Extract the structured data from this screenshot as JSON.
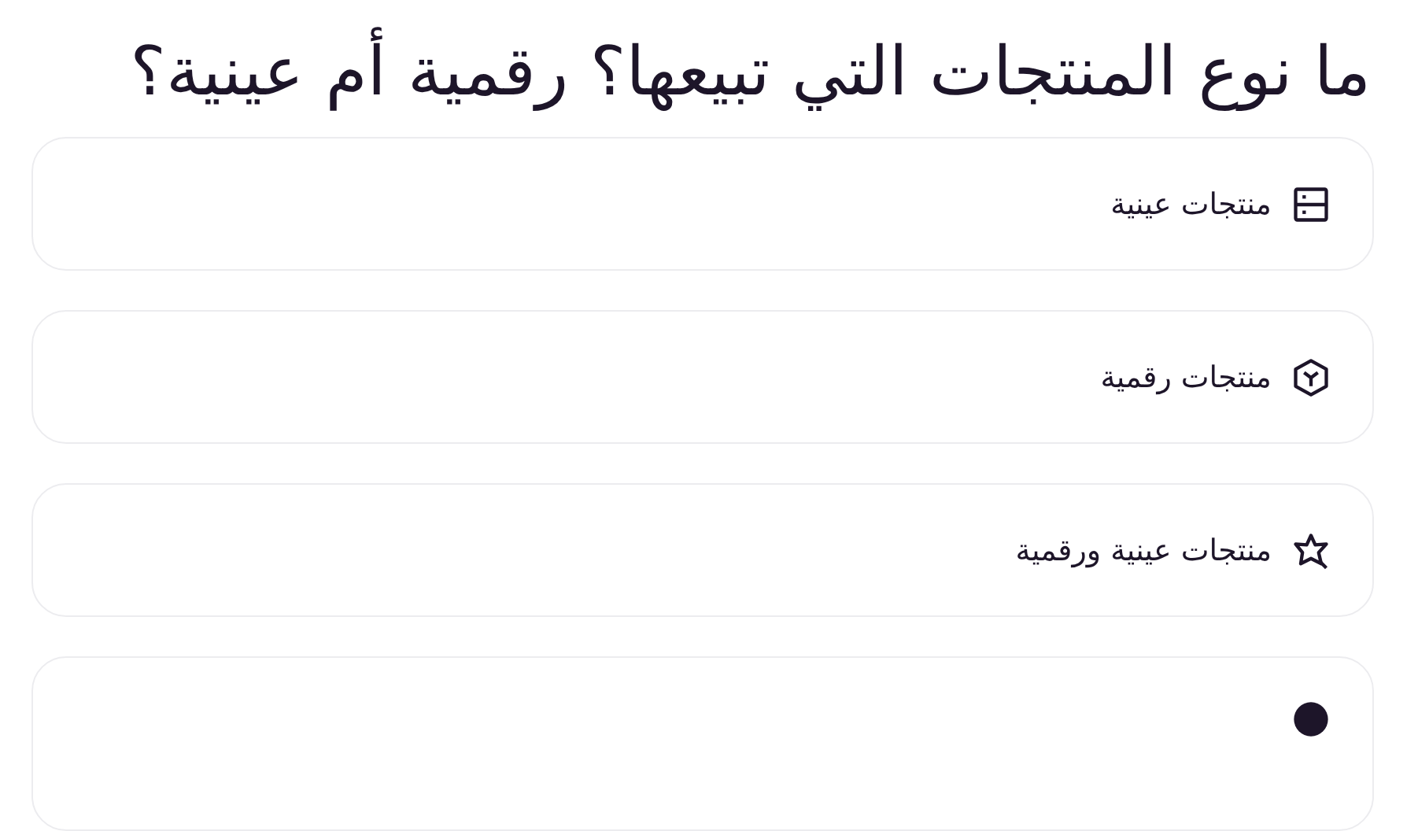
{
  "question": "ما نوع المنتجات التي تبيعها؟ رقمية أم عينية؟",
  "options": [
    {
      "kind": "physical",
      "label": "منتجات عينية"
    },
    {
      "kind": "digital",
      "label": "منتجات رقمية"
    },
    {
      "kind": "both",
      "label": "منتجات عينية ورقمية"
    },
    {
      "kind": "cut"
    }
  ]
}
